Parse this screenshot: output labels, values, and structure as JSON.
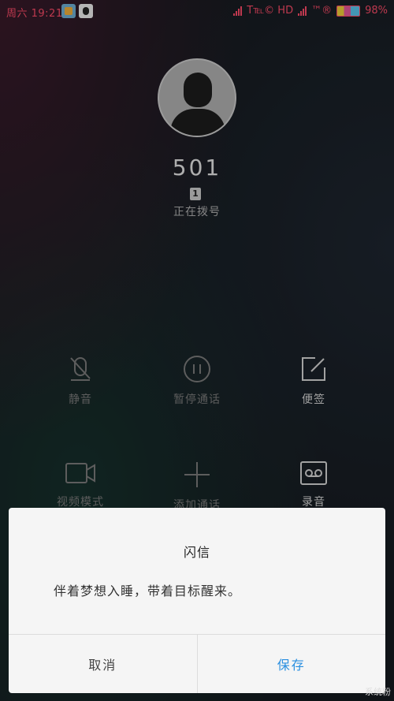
{
  "status_bar": {
    "time": "周六 19:21",
    "carrier_info": "T℡© HD",
    "icons_extra": "™®",
    "battery": "98%"
  },
  "call": {
    "number": "501",
    "sim_label": "1",
    "status": "正在拨号"
  },
  "controls": [
    {
      "label": "静音",
      "icon": "mic-off-icon"
    },
    {
      "label": "暂停通话",
      "icon": "pause-icon"
    },
    {
      "label": "便签",
      "icon": "note-icon"
    },
    {
      "label": "视频模式",
      "icon": "video-icon"
    },
    {
      "label": "添加通话",
      "icon": "add-icon"
    },
    {
      "label": "录音",
      "icon": "record-icon"
    }
  ],
  "dialog": {
    "title": "闪信",
    "message": "伴着梦想入睡，带着目标醒来。",
    "cancel_label": "取消",
    "save_label": "保存"
  },
  "watermark": "系统粉"
}
